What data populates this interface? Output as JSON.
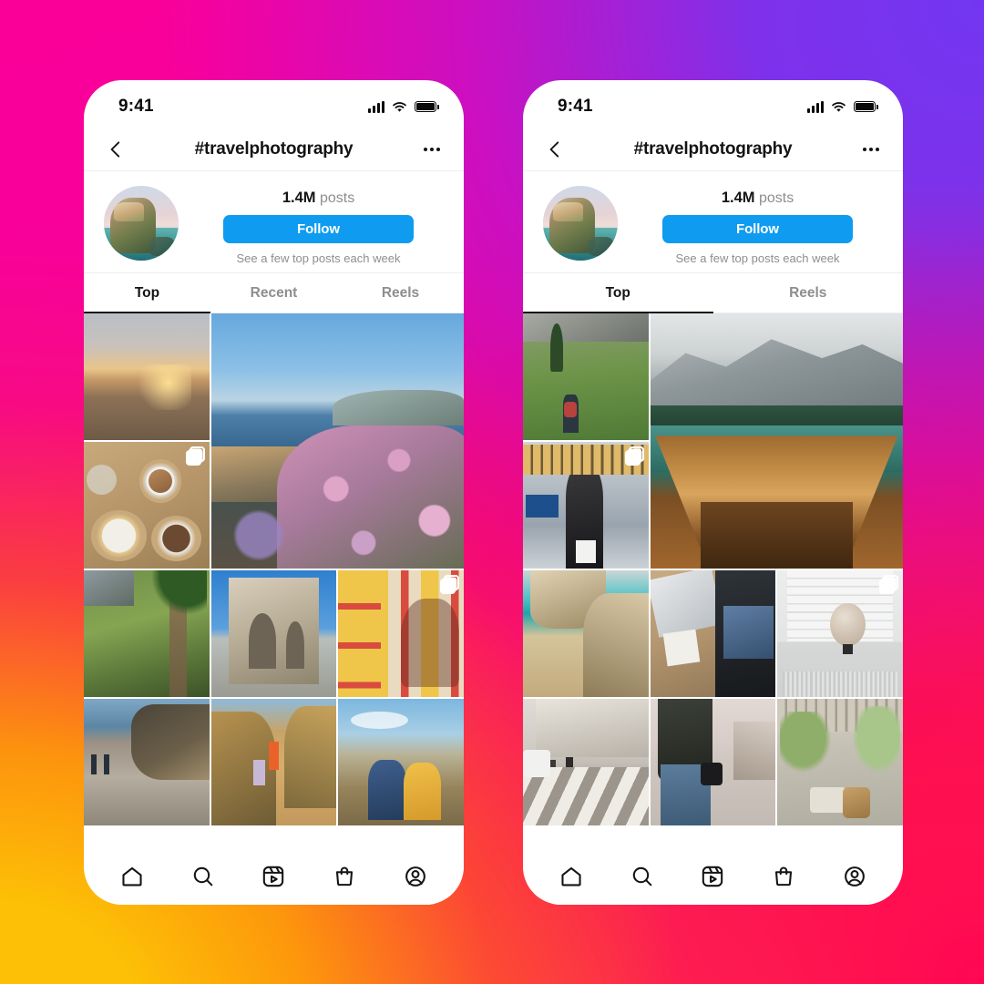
{
  "background": {
    "gradient_colors": [
      "#FB0099",
      "#7236F2",
      "#FDBE08",
      "#FF0654"
    ]
  },
  "theme": {
    "accent_blue": "#0F9BF0",
    "text_primary": "#141414",
    "text_secondary": "#8E8E8E",
    "surface": "#FFFFFF"
  },
  "phones": [
    {
      "id": "left",
      "status_bar": {
        "time": "9:41",
        "icons": [
          "signal-bars-icon",
          "wifi-icon",
          "battery-icon"
        ]
      },
      "navbar": {
        "back_icon": "chevron-left-icon",
        "title": "#travelphotography",
        "more_icon": "ellipsis-icon"
      },
      "profile": {
        "avatar_alt": "coastal cliff village",
        "posts_count": "1.4M",
        "posts_label": "posts",
        "follow_label": "Follow",
        "note": "See a few top posts each week"
      },
      "tabs": [
        {
          "label": "Top",
          "active": true
        },
        {
          "label": "Recent",
          "active": false
        },
        {
          "label": "Reels",
          "active": false
        }
      ],
      "grid": [
        {
          "name": "sunset-beach",
          "style": "p-sunset",
          "big": false,
          "multi": false
        },
        {
          "name": "coastal-flowers",
          "style": "p-coast",
          "big": true,
          "multi": false
        },
        {
          "name": "coffee-table",
          "style": "p-coffee",
          "big": false,
          "multi": true
        },
        {
          "name": "palm-garden",
          "style": "p-palm",
          "big": false,
          "multi": false
        },
        {
          "name": "stone-arch",
          "style": "p-arch",
          "big": false,
          "multi": false
        },
        {
          "name": "striped-wall-shadow",
          "style": "p-stripe",
          "big": false,
          "multi": true
        },
        {
          "name": "pebble-beach",
          "style": "p-pebble",
          "big": false,
          "multi": false
        },
        {
          "name": "canyon-hikers",
          "style": "p-canyon",
          "big": false,
          "multi": false
        },
        {
          "name": "sunset-couple",
          "style": "p-couple",
          "big": false,
          "multi": false
        }
      ],
      "tabbar": [
        "home-icon",
        "search-icon",
        "reels-icon",
        "shop-icon",
        "profile-icon"
      ]
    },
    {
      "id": "right",
      "status_bar": {
        "time": "9:41",
        "icons": [
          "signal-bars-icon",
          "wifi-icon",
          "battery-icon"
        ]
      },
      "navbar": {
        "back_icon": "chevron-left-icon",
        "title": "#travelphotography",
        "more_icon": "ellipsis-icon"
      },
      "profile": {
        "avatar_alt": "coastal cliff village",
        "posts_count": "1.4M",
        "posts_label": "posts",
        "follow_label": "Follow",
        "note": "See a few top posts each week"
      },
      "tabs": [
        {
          "label": "Top",
          "active": true
        },
        {
          "label": "Reels",
          "active": false
        }
      ],
      "grid": [
        {
          "name": "mountain-hiker",
          "style": "p-hiker",
          "big": false,
          "multi": false
        },
        {
          "name": "boat-on-lake",
          "style": "p-boat",
          "big": true,
          "multi": false
        },
        {
          "name": "airport-terminal",
          "style": "p-airport",
          "big": false,
          "multi": true
        },
        {
          "name": "beach-cove",
          "style": "p-cove",
          "big": false,
          "multi": false
        },
        {
          "name": "packed-suitcase",
          "style": "p-pack",
          "big": false,
          "multi": false
        },
        {
          "name": "globe-by-window",
          "style": "p-globe",
          "big": false,
          "multi": true
        },
        {
          "name": "crosswalk-street",
          "style": "p-street",
          "big": false,
          "multi": false
        },
        {
          "name": "photographer",
          "style": "p-photog",
          "big": false,
          "multi": false
        },
        {
          "name": "patio-plants",
          "style": "p-patio",
          "big": false,
          "multi": false
        }
      ],
      "tabbar": [
        "home-icon",
        "search-icon",
        "reels-icon",
        "shop-icon",
        "profile-icon"
      ]
    }
  ]
}
